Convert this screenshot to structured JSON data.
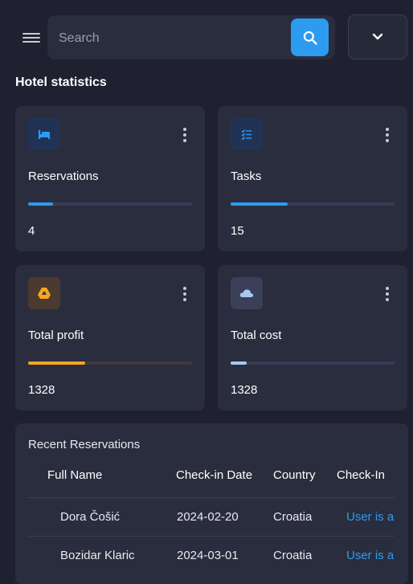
{
  "search": {
    "placeholder": "Search",
    "value": ""
  },
  "icons": {
    "menu": "hamburger-menu-icon",
    "search": "search-icon",
    "dropdown": "chevron-down-icon",
    "more": "more-vertical-icon"
  },
  "page": {
    "section_title": "Hotel statistics"
  },
  "colors": {
    "accent": "#2d9bf0",
    "orange": "#f5a623",
    "light_blue": "#a8c8f0",
    "card_bg": "#2a2d3d",
    "page_bg": "#1f2130"
  },
  "stats": [
    {
      "label": "Reservations",
      "value": "4",
      "icon": "bed-icon",
      "progress_pct": 15,
      "color": "#2d9bf0"
    },
    {
      "label": "Tasks",
      "value": "15",
      "icon": "checklist-icon",
      "progress_pct": 35,
      "color": "#2d9bf0"
    },
    {
      "label": "Total profit",
      "value": "1328",
      "icon": "google-drive-icon",
      "progress_pct": 35,
      "color": "#f5a623"
    },
    {
      "label": "Total cost",
      "value": "1328",
      "icon": "cloud-icon",
      "progress_pct": 10,
      "color": "#a8c8f0"
    }
  ],
  "recent": {
    "title": "Recent Reservations",
    "columns": [
      "Full Name",
      "Check-in Date",
      "Country",
      "Check-In"
    ],
    "rows": [
      {
        "name": "Dora Čošić",
        "date": "2024-02-20",
        "country": "Croatia",
        "checkin": "User is a"
      },
      {
        "name": "Bozidar Klaric",
        "date": "2024-03-01",
        "country": "Croatia",
        "checkin": "User is a"
      }
    ]
  }
}
